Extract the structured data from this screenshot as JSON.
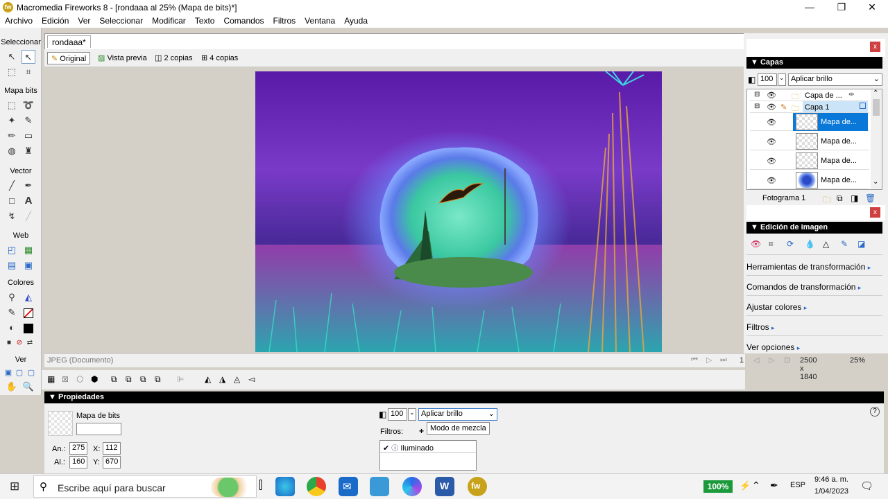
{
  "window": {
    "title": "Macromedia Fireworks 8 - [rondaaa al  25% (Mapa de bits)*]",
    "app_icon_letter": "fw",
    "minimize": "—",
    "maximize": "❐",
    "close": "✕"
  },
  "menu": [
    "Archivo",
    "Edición",
    "Ver",
    "Seleccionar",
    "Modificar",
    "Texto",
    "Comandos",
    "Filtros",
    "Ventana",
    "Ayuda"
  ],
  "toolbox": {
    "seleccionar": "Seleccionar",
    "mapa_de_bits": "Mapa bits",
    "vector": "Vector",
    "web": "Web",
    "colores": "Colores",
    "ver": "Ver"
  },
  "document": {
    "tab": "rondaaa*",
    "views": {
      "original": "Original",
      "preview": "Vista previa",
      "two": "2 copias",
      "four": "4 copias"
    },
    "status_left": "JPEG (Documento)",
    "frame": "1",
    "dimensions": "2500 x 1840",
    "zoom": "25%"
  },
  "layers_panel": {
    "title": "Capas",
    "opacity": "100",
    "blend": "Aplicar brillo",
    "rows": [
      {
        "name": "Capa de ..."
      },
      {
        "name": "Capa 1"
      },
      {
        "name": "Mapa de..."
      },
      {
        "name": "Mapa de..."
      },
      {
        "name": "Mapa de..."
      },
      {
        "name": "Mapa de..."
      }
    ],
    "frame_label": "Fotograma 1"
  },
  "image_edit_panel": {
    "title": "Edición de imagen",
    "items": [
      "Herramientas de transformación",
      "Comandos de transformación",
      "Ajustar colores",
      "Filtros",
      "Ver opciones"
    ]
  },
  "properties": {
    "title": "Propiedades",
    "object_type": "Mapa de bits",
    "w_label": "An.:",
    "w": "275",
    "x_label": "X:",
    "x": "112",
    "h_label": "Al.:",
    "h": "160",
    "y_label": "Y:",
    "y": "670",
    "opacity": "100",
    "blend": "Aplicar brillo",
    "tooltip": "Modo de mezcla",
    "filters_label": "Filtros:",
    "filter_item": "Iluminado",
    "help": "?"
  },
  "taskbar": {
    "search_placeholder": "Escribe aquí para buscar",
    "battery": "100%",
    "lang": "ESP",
    "time": "9:46 a. m.",
    "date": "1/04/2023"
  }
}
